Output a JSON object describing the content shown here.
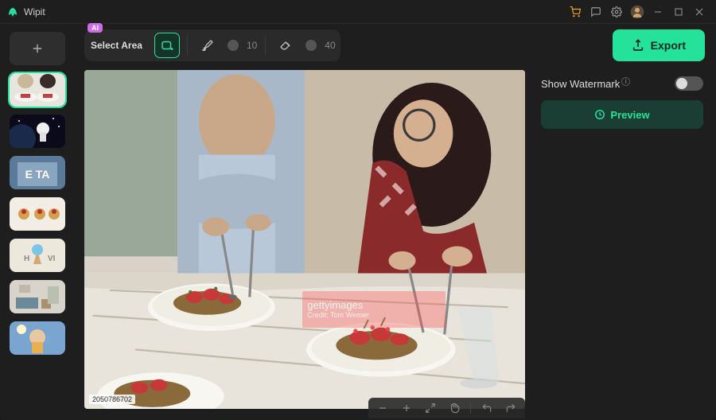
{
  "app": {
    "title": "Wipit"
  },
  "titlebar_icons": [
    "cart-icon",
    "chat-icon",
    "gear-icon",
    "user-icon",
    "minimize-icon",
    "maximize-icon",
    "close-icon"
  ],
  "toolbar": {
    "ai_badge": "AI",
    "select_label": "Select Area",
    "brush_size": "10",
    "eraser_size": "40",
    "export_label": "Export"
  },
  "right": {
    "watermark_label": "Show Watermark",
    "watermark_on": false,
    "preview_label": "Preview"
  },
  "canvas": {
    "watermark_text1": "gettyimages",
    "watermark_text2": "Credit: Tom Werner",
    "image_id": "2050786702"
  },
  "thumbnails": [
    {
      "name": "thumb-food",
      "active": true
    },
    {
      "name": "thumb-astronaut",
      "active": false
    },
    {
      "name": "thumb-building",
      "active": false
    },
    {
      "name": "thumb-appetizers",
      "active": false
    },
    {
      "name": "thumb-icecream",
      "active": false
    },
    {
      "name": "thumb-livingroom",
      "active": false
    },
    {
      "name": "thumb-portrait",
      "active": false
    }
  ]
}
